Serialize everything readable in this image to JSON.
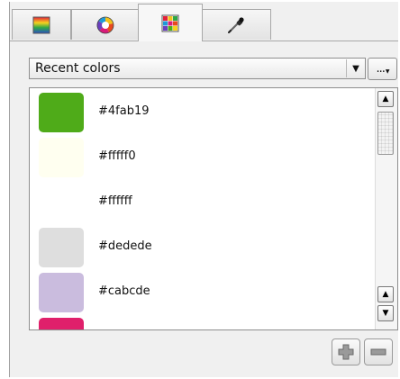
{
  "tabs": [
    {
      "icon": "color-ramp-icon",
      "active": false
    },
    {
      "icon": "color-wheel-icon",
      "active": false
    },
    {
      "icon": "swatch-grid-icon",
      "active": true
    },
    {
      "icon": "eyedropper-icon",
      "active": false
    }
  ],
  "dropdown": {
    "selected": "Recent colors",
    "arrow": "▼"
  },
  "more_button": {
    "label": "..."
  },
  "colors": [
    {
      "hex": "#4fab19",
      "swatch": "#4fab19"
    },
    {
      "hex": "#fffff0",
      "swatch": "#fffff0"
    },
    {
      "hex": "#ffffff",
      "swatch": "#ffffff"
    },
    {
      "hex": "#dedede",
      "swatch": "#dedede"
    },
    {
      "hex": "#cabcde",
      "swatch": "#cabcde"
    },
    {
      "hex": "",
      "swatch": "#e0206b"
    }
  ],
  "scrollbar": {
    "up_glyph": "▲",
    "down_glyph": "▼"
  }
}
